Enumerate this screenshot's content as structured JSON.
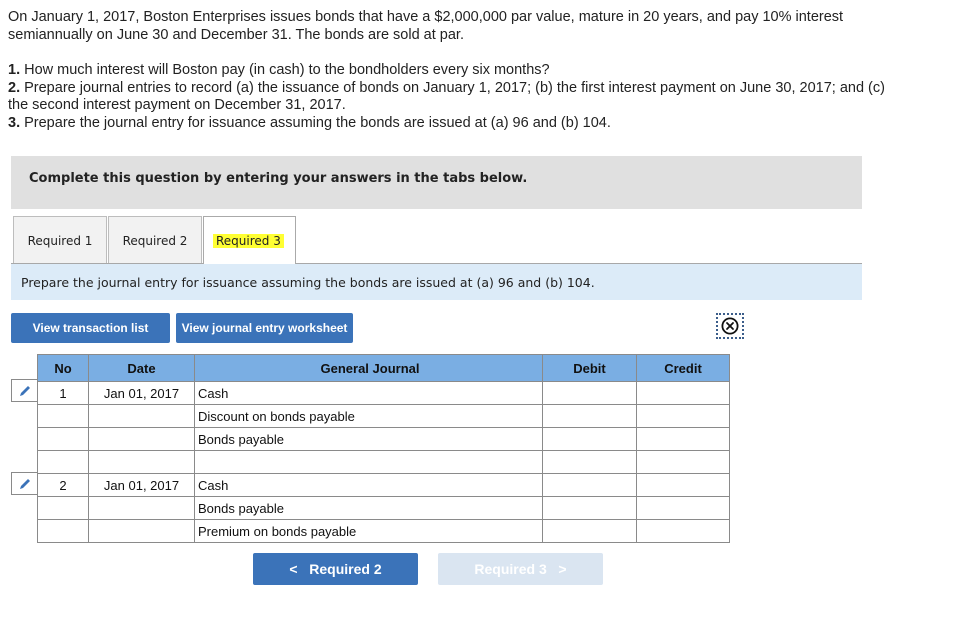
{
  "problem": {
    "intro_line1": "On January 1, 2017, Boston Enterprises issues bonds that have a $2,000,000 par value, mature in 20 years, and pay 10% interest",
    "intro_line2": "semiannually on June 30 and December 31. The bonds are sold at par.",
    "q1_num": "1.",
    "q1_text": " How much interest will Boston pay (in cash) to the bondholders every six months?",
    "q2_num": "2.",
    "q2_text": " Prepare journal entries to record (a) the issuance of bonds on January 1, 2017; (b) the first interest payment on June 30, 2017; and (c)",
    "q2_text_cont": "the second interest payment on December 31, 2017.",
    "q3_num": "3.",
    "q3_text": " Prepare the journal entry for issuance assuming the bonds are issued at (a) 96 and (b) 104."
  },
  "banner": {
    "text": "Complete this question by entering your answers in the tabs below."
  },
  "tabs": [
    {
      "label": "Required 1",
      "active": false
    },
    {
      "label": "Required 2",
      "active": false
    },
    {
      "label": "Required 3",
      "active": true
    }
  ],
  "instruction": "Prepare the journal entry for issuance assuming the bonds are issued at (a) 96 and (b) 104.",
  "buttons": {
    "view_transaction_list": "View transaction list",
    "view_journal_entry_worksheet": "View journal entry worksheet"
  },
  "icons": {
    "close": "circle-x-icon",
    "edit": "pencil-icon"
  },
  "journal": {
    "headers": {
      "no": "No",
      "date": "Date",
      "general_journal": "General Journal",
      "debit": "Debit",
      "credit": "Credit"
    },
    "rows": [
      {
        "no": "1",
        "date": "Jan 01, 2017",
        "account": "Cash",
        "debit": "",
        "credit": ""
      },
      {
        "no": "",
        "date": "",
        "account": "Discount on bonds payable",
        "debit": "",
        "credit": ""
      },
      {
        "no": "",
        "date": "",
        "account": "Bonds payable",
        "debit": "",
        "credit": ""
      },
      {
        "no": "",
        "date": "",
        "account": "",
        "debit": "",
        "credit": ""
      },
      {
        "no": "2",
        "date": "Jan 01, 2017",
        "account": "Cash",
        "debit": "",
        "credit": ""
      },
      {
        "no": "",
        "date": "",
        "account": "Bonds payable",
        "debit": "",
        "credit": ""
      },
      {
        "no": "",
        "date": "",
        "account": "Premium on bonds payable",
        "debit": "",
        "credit": ""
      }
    ]
  },
  "navigation": {
    "prev_label": "Required 2",
    "prev_chevron": "<",
    "next_label": "Required 3",
    "next_chevron": ">"
  },
  "colors": {
    "primary_button": "#3b73b9",
    "table_header": "#7aaee3",
    "instruction_bg": "#dcebf8",
    "banner_bg": "#e0e0e0",
    "highlight": "#ffff33",
    "disabled_button": "#dae5f1"
  }
}
